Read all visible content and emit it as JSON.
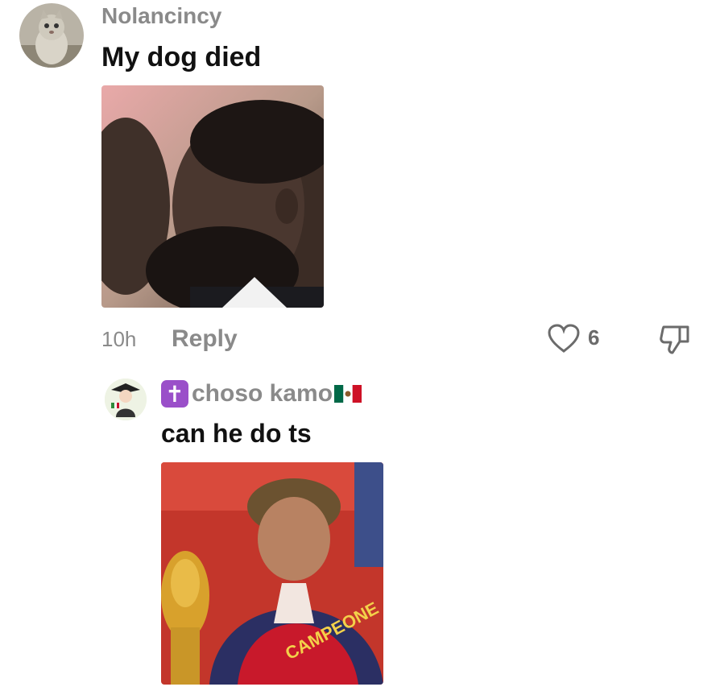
{
  "comments": [
    {
      "username": "Nolancincy",
      "text": "My dog died",
      "time": "10h",
      "reply_label": "Reply",
      "like_count": "6",
      "avatar_icon": "cat-photo-avatar",
      "media_icon": "crying-man-photo"
    }
  ],
  "replies": [
    {
      "badge_icon": "latin-cross-emoji",
      "username": "choso kamo",
      "flag_icon": "mexico-flag-emoji",
      "text": "can he do ts",
      "avatar_icon": "character-avatar",
      "media_icon": "player-with-trophy-photo",
      "media_caption": "CAMPEONE"
    }
  ],
  "colors": {
    "username": "#8a8a8a",
    "text": "#111111",
    "badge": "#9a4fc9",
    "icons": "#6b6b6b"
  }
}
